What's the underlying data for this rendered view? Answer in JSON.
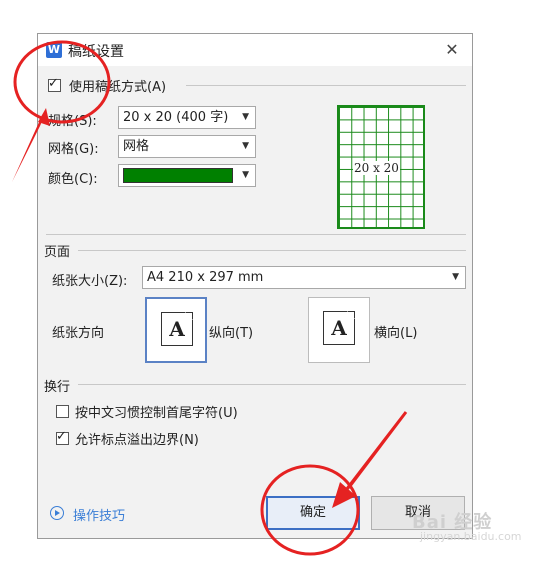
{
  "dialog": {
    "app_icon": "W",
    "title": "稿纸设置",
    "close_icon": "✕",
    "use_manuscript": {
      "label": "使用稿纸方式(A)",
      "checked": true
    },
    "spec": {
      "label": "规格(S):",
      "value": "20 x 20 (400 字)"
    },
    "grid": {
      "label": "网格(G):",
      "value": "网格"
    },
    "color": {
      "label": "颜色(C):",
      "value": "#008000"
    },
    "preview": {
      "label": "20 x 20"
    },
    "page_section": {
      "title": "页面",
      "paper_size_label": "纸张大小(Z):",
      "paper_size_value": "A4 210 x 297 mm",
      "orientation_label": "纸张方向",
      "portrait_label": "纵向(T)",
      "landscape_label": "横向(L)",
      "selected": "portrait",
      "doc_glyph": "A"
    },
    "line_break_section": {
      "title": "换行",
      "option1": {
        "label": "按中文习惯控制首尾字符(U)",
        "checked": false
      },
      "option2": {
        "label": "允许标点溢出边界(N)",
        "checked": true
      }
    },
    "tips_link": "操作技巧",
    "ok_button": "确定",
    "cancel_button": "取消"
  },
  "watermark": {
    "text": "Bai 经验",
    "sub": "jingyan.baidu.com"
  },
  "colors": {
    "annotation_red": "#e52222",
    "accent_blue": "#3a7ed6",
    "grid_green": "#1a8a1a"
  }
}
